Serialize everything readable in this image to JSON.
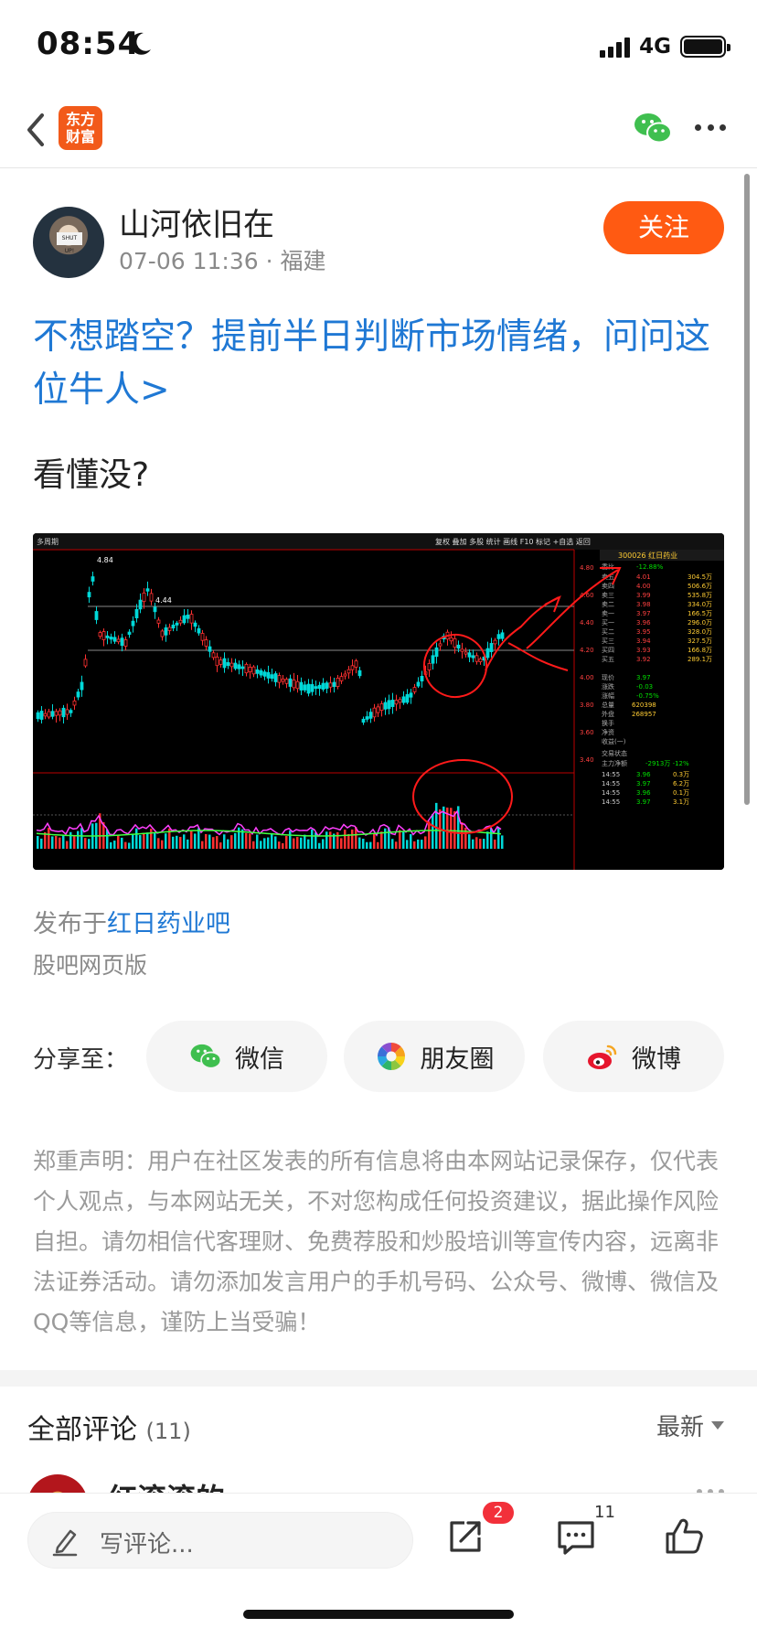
{
  "status_bar": {
    "time": "08:54",
    "network": "4G"
  },
  "nav": {
    "logo_text_line1": "东方",
    "logo_text_line2": "财富"
  },
  "author": {
    "name": "山河依旧在",
    "meta": "07-06 11:36 · 福建",
    "follow_label": "关注",
    "avatar_sign": "SHUT UP!"
  },
  "post": {
    "link_text": "不想踏空？提前半日判断市场情绪，问问这位牛人>",
    "body": "看懂没?",
    "published_prefix": "发布于",
    "board_name": "红日药业吧",
    "web_version": "股吧网页版"
  },
  "stock_chart_image": {
    "code_name": "300026 红日药业",
    "price_high": "4.84",
    "price_mark": "4.44",
    "toolbar": "复权 叠加 多股 统计 画线 F10 标记 +自选 返回",
    "order_book": [
      {
        "label": "卖五",
        "price": "4.01",
        "vol": "304.5万"
      },
      {
        "label": "卖四",
        "price": "4.00",
        "vol": "506.6万"
      },
      {
        "label": "卖三",
        "price": "3.99",
        "vol": "535.8万"
      },
      {
        "label": "卖二",
        "price": "3.98",
        "vol": "334.0万"
      },
      {
        "label": "卖一",
        "price": "3.97",
        "vol": "166.5万"
      },
      {
        "label": "买一",
        "price": "3.96",
        "vol": "296.0万"
      },
      {
        "label": "买二",
        "price": "3.95",
        "vol": "328.0万"
      },
      {
        "label": "买三",
        "price": "3.94",
        "vol": "327.5万"
      },
      {
        "label": "买四",
        "price": "3.93",
        "vol": "166.8万"
      },
      {
        "label": "买五",
        "price": "3.92",
        "vol": "289.1万"
      }
    ],
    "ratio": "-12.88%",
    "main_flow": "-2913万 -12%",
    "trades": [
      {
        "time": "14:55",
        "price": "3.96",
        "vol": "0.3万"
      },
      {
        "time": "14:55",
        "price": "3.97",
        "vol": "6.2万"
      },
      {
        "time": "14:55",
        "price": "3.96",
        "vol": "0.1万"
      },
      {
        "time": "14:55",
        "price": "3.97",
        "vol": "3.1万"
      }
    ],
    "colors": {
      "up": "#ff3030",
      "down": "#00d8d8",
      "ma5": "#ffffff",
      "vol_ma": "#ff40ff",
      "vol_ma2": "#40ff40"
    }
  },
  "share": {
    "label": "分享至：",
    "wechat": "微信",
    "moments": "朋友圈",
    "weibo": "微博"
  },
  "disclaimer": "郑重声明：用户在社区发表的所有信息将由本网站记录保存，仅代表个人观点，与本网站无关，不对您构成任何投资建议，据此操作风险自担。请勿相信代客理财、免费荐股和炒股培训等宣传内容，远离非法证券活动。请勿添加发言用户的手机号码、公众号、微博、微信及QQ等信息，谨防上当受骗！",
  "comments": {
    "title": "全部评论",
    "count": "(11)",
    "sort_label": "最新",
    "first_commenter": "红滚滚的"
  },
  "bottom_bar": {
    "placeholder": "写评论...",
    "share_badge": "2",
    "comment_count": "11"
  },
  "icons": [
    "back-icon",
    "wechat-icon",
    "more-icon",
    "wechat-share-icon",
    "moments-icon",
    "weibo-icon",
    "pen-icon",
    "share-out-icon",
    "comment-icon",
    "like-icon",
    "moon-icon"
  ]
}
